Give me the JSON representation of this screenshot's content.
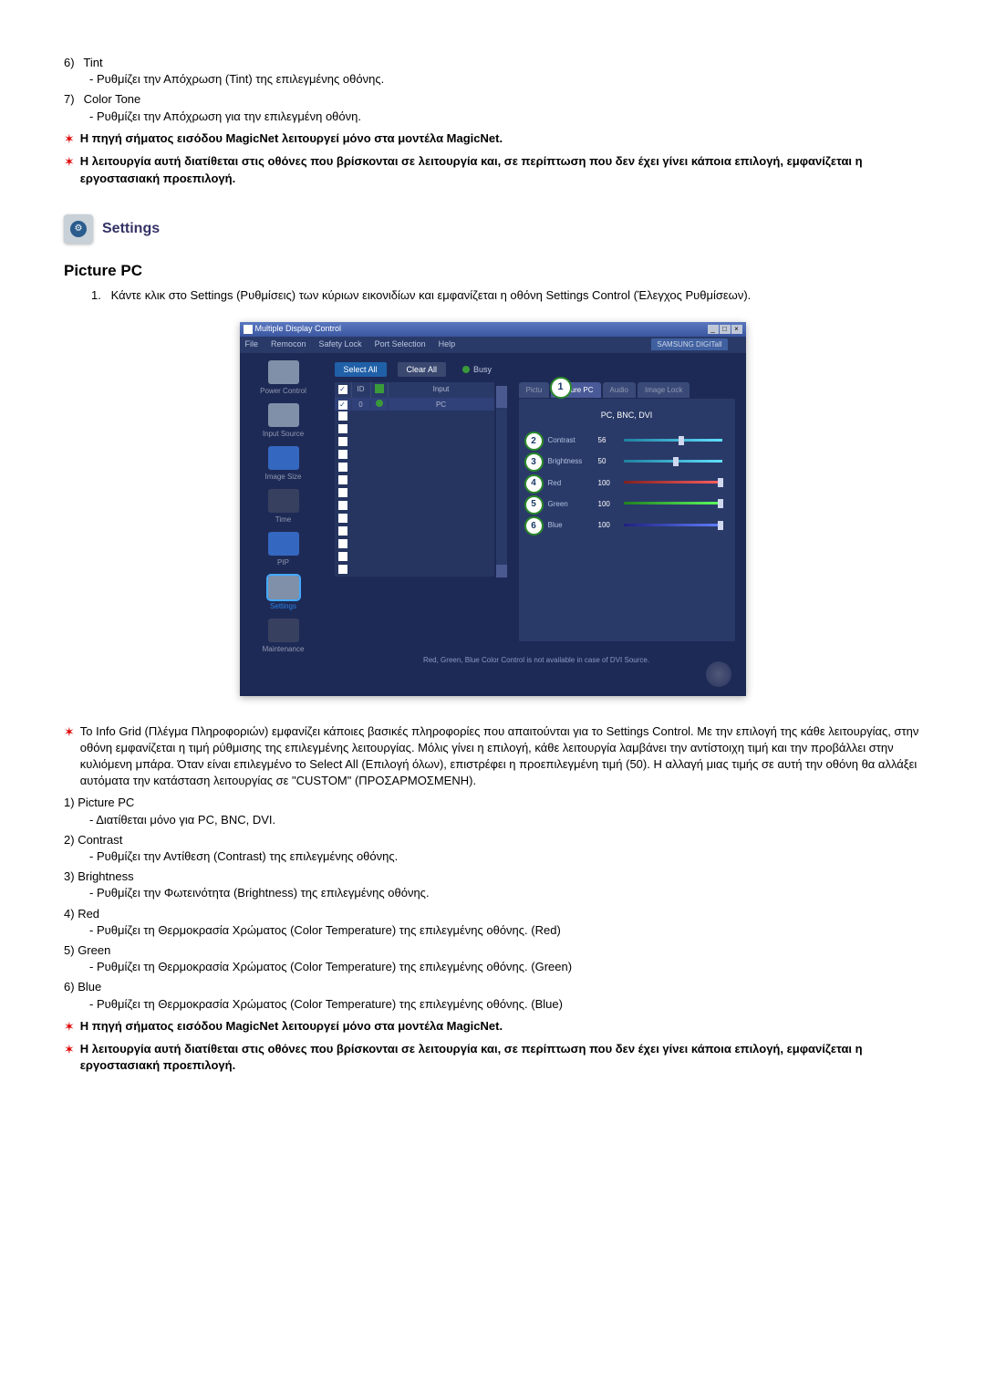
{
  "top": {
    "item6_num": "6)",
    "item6_label": "Tint",
    "item6_desc": "- Ρυθμίζει την Απόχρωση (Tint) της επιλεγμένης οθόνης.",
    "item7_num": "7)",
    "item7_label": "Color Tone",
    "item7_desc": "- Ρυθμίζει την Απόχρωση για την επιλεγμένη οθόνη.",
    "note1": "Η πηγή σήματος εισόδου MagicNet λειτουργεί μόνο στα μοντέλα MagicNet.",
    "note2": "Η λειτουργία αυτή διατίθεται στις οθόνες που βρίσκονται σε λειτουργία και, σε περίπτωση που δεν έχει γίνει κάποια επιλογή, εμφανίζεται η εργοστασιακή προεπιλογή."
  },
  "section": {
    "title": "Settings",
    "sub": "Picture PC",
    "step1_num": "1.",
    "step1_text": "Κάντε κλικ στο Settings (Ρυθμίσεις) των κύριων εικονιδίων και εμφανίζεται η οθόνη Settings Control (Έλεγχος Ρυθμίσεων)."
  },
  "app": {
    "title": "Multiple Display Control",
    "menu": {
      "file": "File",
      "remocon": "Remocon",
      "safety": "Safety Lock",
      "port": "Port Selection",
      "help": "Help"
    },
    "logo": "SAMSUNG DIGITall",
    "sidebar": {
      "power": "Power Control",
      "input": "Input Source",
      "image": "Image Size",
      "time": "Time",
      "pip": "PIP",
      "settings": "Settings",
      "maint": "Maintenance"
    },
    "buttons": {
      "select": "Select All",
      "clear": "Clear All",
      "busy": "Busy"
    },
    "grid": {
      "h_id": "ID",
      "h_input": "Input",
      "row_id": "0",
      "row_input": "PC"
    },
    "tabs": {
      "pict": "Pictu",
      "picpc": "Picture PC",
      "audio": "Audio",
      "imgl": "Image Lock"
    },
    "panel": {
      "title": "PC, BNC, DVI",
      "contrast": "Contrast",
      "contrast_v": "56",
      "brightness": "Brightness",
      "brightness_v": "50",
      "red": "Red",
      "red_v": "100",
      "green": "Green",
      "green_v": "100",
      "blue": "Blue",
      "blue_v": "100"
    },
    "footer": "Red, Green, Blue Color Control is not available in case of DVI Source.",
    "circles": {
      "c1": "1",
      "c2": "2",
      "c3": "3",
      "c4": "4",
      "c5": "5",
      "c6": "6"
    }
  },
  "notes": {
    "para": "Το Info Grid (Πλέγμα Πληροφοριών) εμφανίζει κάποιες βασικές πληροφορίες που απαιτούνται για το Settings Control. Με την επιλογή της κάθε λειτουργίας, στην οθόνη εμφανίζεται η τιμή ρύθμισης της επιλεγμένης λειτουργίας. Μόλις γίνει η επιλογή, κάθε λειτουργία λαμβάνει την αντίστοιχη τιμή και την προβάλλει στην κυλιόμενη μπάρα. Όταν είναι επιλεγμένο το Select All (Επιλογή όλων), επιστρέφει η προεπιλεγμένη τιμή (50). Η αλλαγή μιας τιμής σε αυτή την οθόνη θα αλλάξει αυτόματα την κατάσταση λειτουργίας σε \"CUSTOM\" (ΠΡΟΣΑΡΜΟΣΜΕΝΗ).",
    "i1_n": "1)",
    "i1_l": "Picture PC",
    "i1_d": "- Διατίθεται μόνο για PC, BNC, DVI.",
    "i2_n": "2)",
    "i2_l": "Contrast",
    "i2_d": "- Ρυθμίζει την Αντίθεση (Contrast) της επιλεγμένης οθόνης.",
    "i3_n": "3)",
    "i3_l": "Brightness",
    "i3_d": "- Ρυθμίζει την Φωτεινότητα (Brightness) της επιλεγμένης οθόνης.",
    "i4_n": "4)",
    "i4_l": "Red",
    "i4_d": "- Ρυθμίζει τη Θερμοκρασία Χρώματος (Color Temperature) της επιλεγμένης οθόνης. (Red)",
    "i5_n": "5)",
    "i5_l": "Green",
    "i5_d": "- Ρυθμίζει τη Θερμοκρασία Χρώματος (Color Temperature) της επιλεγμένης οθόνης. (Green)",
    "i6_n": "6)",
    "i6_l": "Blue",
    "i6_d": "- Ρυθμίζει τη Θερμοκρασία Χρώματος (Color Temperature) της επιλεγμένης οθόνης. (Blue)",
    "note1": "Η πηγή σήματος εισόδου MagicNet λειτουργεί μόνο στα μοντέλα MagicNet.",
    "note2": "Η λειτουργία αυτή διατίθεται στις οθόνες που βρίσκονται σε λειτουργία και, σε περίπτωση που δεν έχει γίνει κάποια επιλογή, εμφανίζεται η εργοστασιακή προεπιλογή."
  }
}
